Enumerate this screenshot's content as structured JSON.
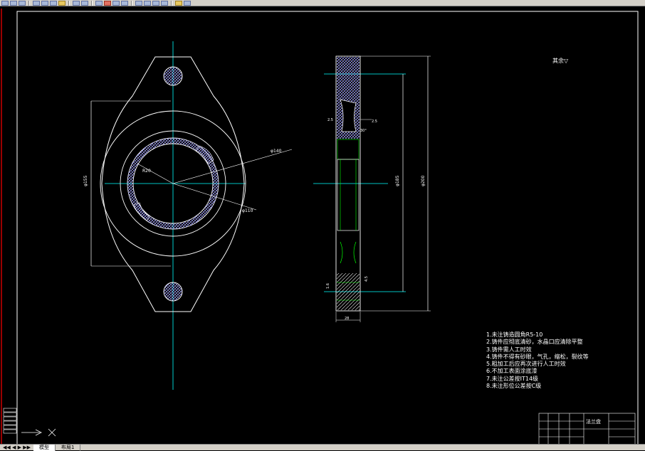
{
  "window": {
    "toolbar_icons": [
      "new-icon",
      "open-icon",
      "save-icon",
      "print-icon",
      "cut-icon",
      "copy-icon",
      "paste-icon",
      "undo-icon",
      "redo-icon",
      "pan-icon",
      "zoom-icon",
      "zoom-window-icon",
      "zoom-previous-icon",
      "properties-icon",
      "design-center-icon",
      "tool-palettes-icon",
      "calculator-icon",
      "layer-icon",
      "help-icon"
    ]
  },
  "drawing": {
    "front_view": {
      "dim_left": "φ155",
      "dim_r": "R20",
      "dim_bore": "φ110",
      "dim_bolt": "φ140"
    },
    "side_view": {
      "dim_h1": "φ185",
      "dim_h2": "φ200",
      "dim_small1": "2.5",
      "dim_small2": "2.5",
      "dim_angle": "30°",
      "dim_bottom": "28",
      "dim_left1": "1.6",
      "dim_left2": "4.5"
    },
    "roughness": "其余▽"
  },
  "notes": [
    "1.未注铸造圆角R5-10",
    "2.铸件应彻底清砂，水晶口应清除平整",
    "3.铸件需人工时效",
    "4.铸件不得有砂眼，气孔，缩松，裂纹等",
    "5.粗加工后应再次进行人工时效",
    "6.不加工表面涂底漆",
    "7.未注公差按IT14级",
    "8.未注形位公差按C级"
  ],
  "title_block": {
    "part_name": "法兰盘"
  },
  "status": {
    "tabs": [
      "模型",
      "布局1"
    ],
    "active_tab": "模型"
  },
  "colors": {
    "background": "#000000",
    "line": "#ffffff",
    "center": "#00ffff",
    "hatch": "#8080ff",
    "frame_left": "#ff0000"
  }
}
